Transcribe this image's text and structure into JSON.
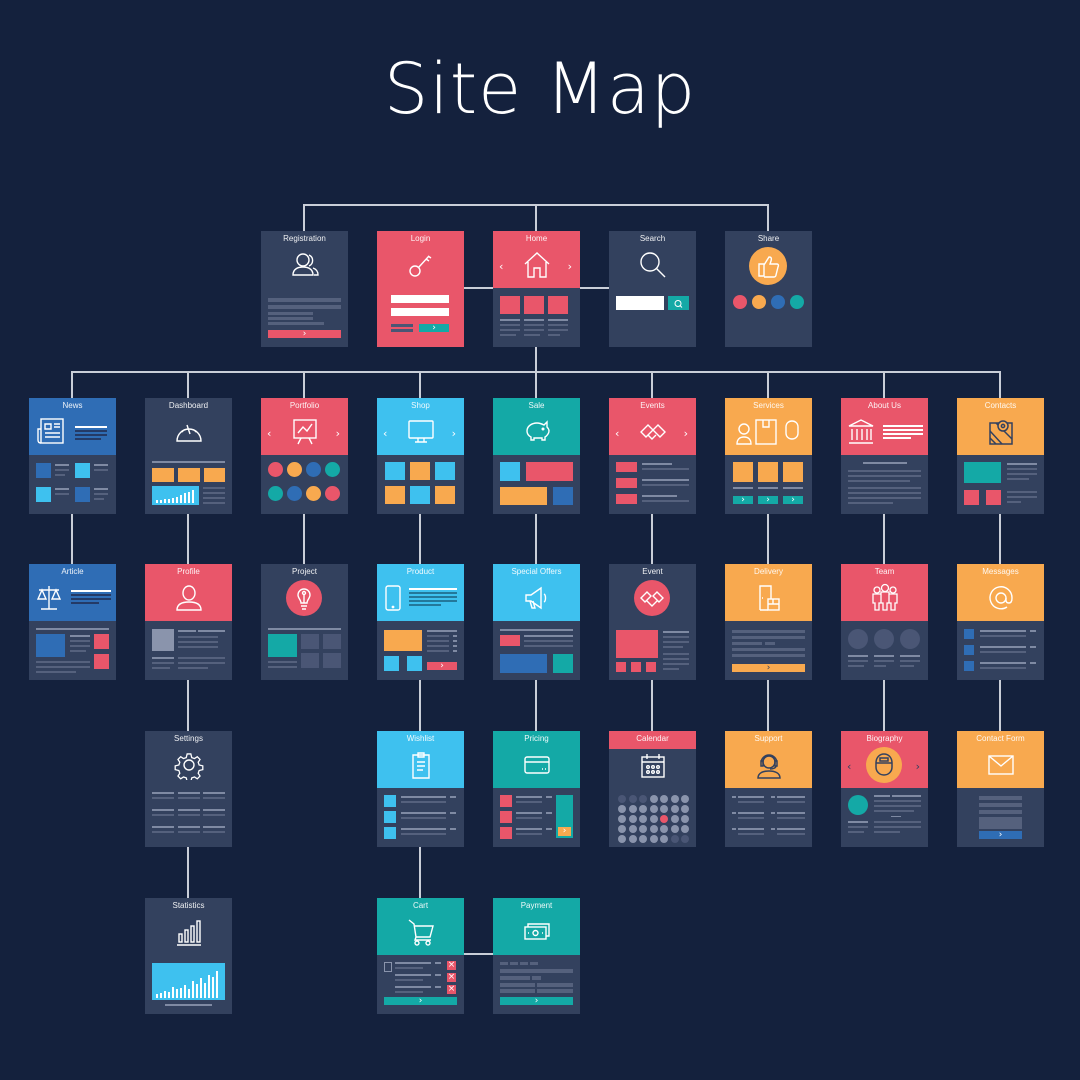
{
  "title": "Site Map",
  "colors": {
    "background": "#14213d",
    "card": "#33415e",
    "red": "#e9566a",
    "blue": "#2f6db5",
    "sky": "#3ec1ef",
    "teal": "#14a9a6",
    "orange": "#f8a94f",
    "connector": "#c9ced8"
  },
  "pages": {
    "registration": {
      "label": "Registration",
      "icon": "users-icon"
    },
    "login": {
      "label": "Login",
      "icon": "key-icon"
    },
    "home": {
      "label": "Home",
      "icon": "house-icon"
    },
    "search": {
      "label": "Search",
      "icon": "magnifier-icon"
    },
    "share": {
      "label": "Share",
      "icon": "thumbs-up-icon"
    },
    "news": {
      "label": "News",
      "icon": "newspaper-icon"
    },
    "dashboard": {
      "label": "Dashboard",
      "icon": "gauge-icon"
    },
    "portfolio": {
      "label": "Portfolio",
      "icon": "presentation-icon"
    },
    "shop": {
      "label": "Shop",
      "icon": "monitor-icon"
    },
    "sale": {
      "label": "Sale",
      "icon": "piggy-bank-icon"
    },
    "events": {
      "label": "Events",
      "icon": "handshake-icon"
    },
    "services": {
      "label": "Services",
      "icon": "box-icon"
    },
    "about_us": {
      "label": "About Us",
      "icon": "bank-icon"
    },
    "contacts": {
      "label": "Contacts",
      "icon": "map-pin-icon"
    },
    "article": {
      "label": "Article",
      "icon": "scales-icon"
    },
    "profile": {
      "label": "Profile",
      "icon": "user-icon"
    },
    "project": {
      "label": "Project",
      "icon": "lightbulb-icon"
    },
    "product": {
      "label": "Product",
      "icon": "phone-icon"
    },
    "special_offers": {
      "label": "Special Offers",
      "icon": "megaphone-icon"
    },
    "event": {
      "label": "Event",
      "icon": "handshake-icon"
    },
    "delivery": {
      "label": "Delivery",
      "icon": "door-box-icon"
    },
    "team": {
      "label": "Team",
      "icon": "team-icon"
    },
    "messages": {
      "label": "Messages",
      "icon": "at-sign-icon"
    },
    "settings": {
      "label": "Settings",
      "icon": "gear-icon"
    },
    "wishlist": {
      "label": "Wishlist",
      "icon": "clipboard-icon"
    },
    "pricing": {
      "label": "Pricing",
      "icon": "credit-card-icon"
    },
    "calendar": {
      "label": "Calendar",
      "icon": "calendar-icon"
    },
    "support": {
      "label": "Support",
      "icon": "headset-icon"
    },
    "biography": {
      "label": "Biography",
      "icon": "avatar-cap-icon"
    },
    "contact_form": {
      "label": "Contact Form",
      "icon": "envelope-icon"
    },
    "statistics": {
      "label": "Statistics",
      "icon": "bar-chart-icon"
    },
    "cart": {
      "label": "Cart",
      "icon": "cart-icon"
    },
    "payment": {
      "label": "Payment",
      "icon": "cash-icon"
    }
  },
  "glyphs": {
    "next": "›",
    "prev": "‹",
    "remove": "×"
  }
}
